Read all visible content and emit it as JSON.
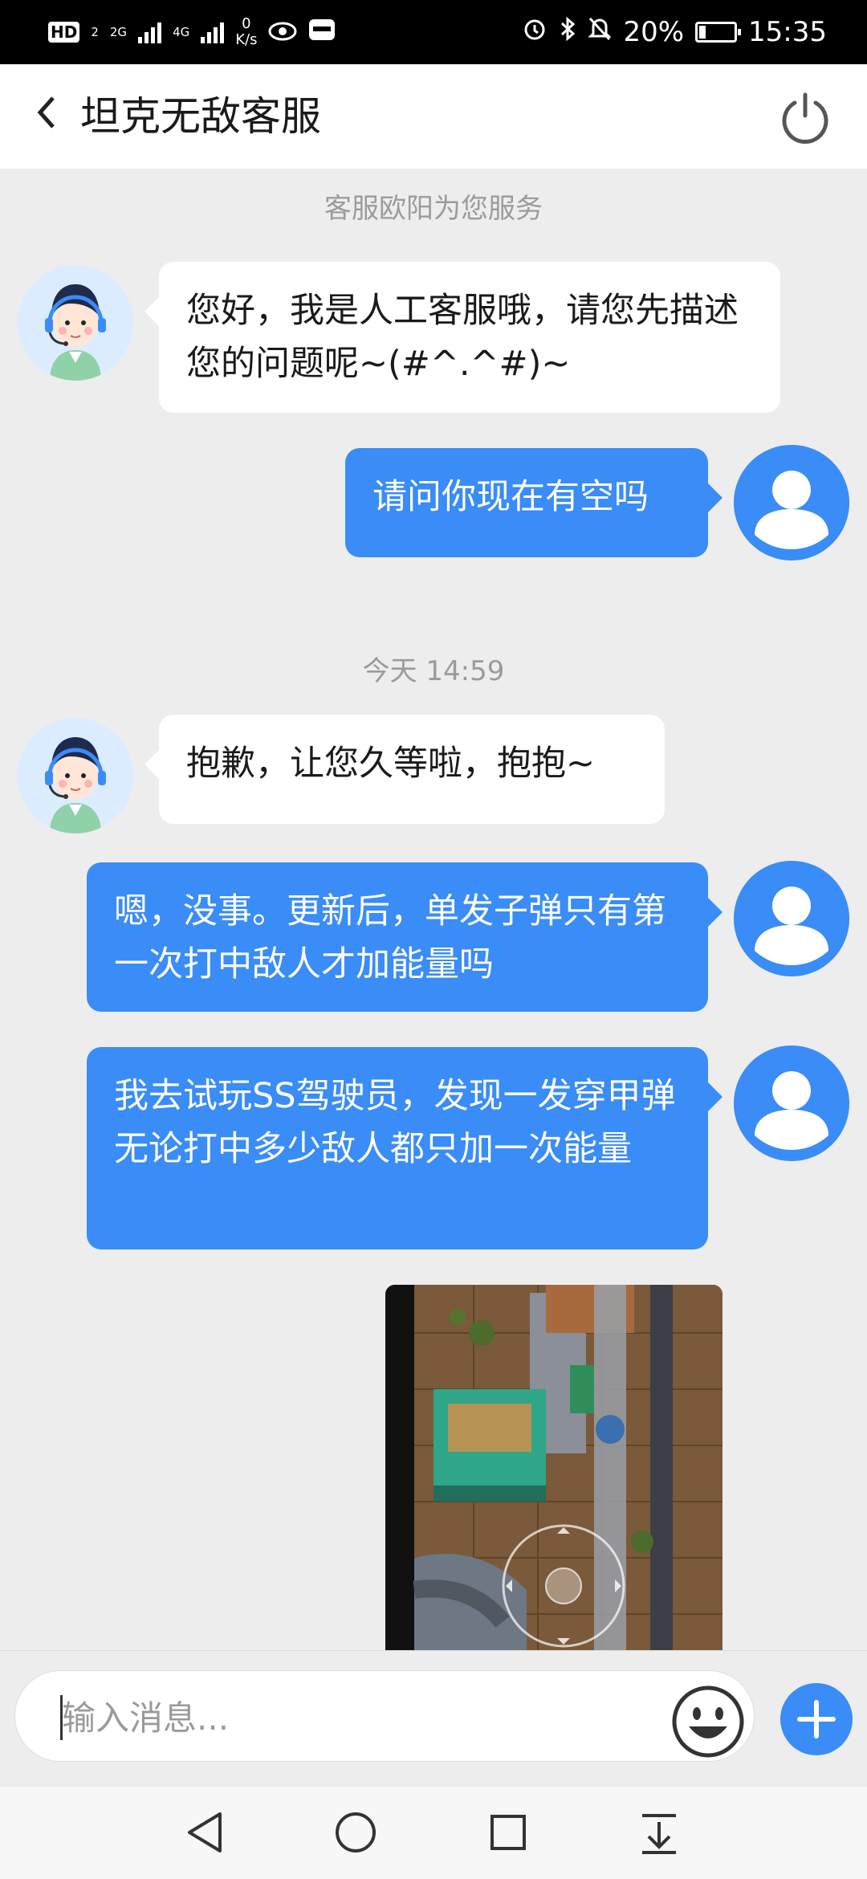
{
  "status_bar": {
    "hd_label": "HD",
    "sim1": "2",
    "net1": "2G",
    "net2": "4G",
    "speed_value": "0",
    "speed_unit": "K/s",
    "battery": "20%",
    "time": "15:35"
  },
  "header": {
    "title": "坦克无敌客服"
  },
  "chat": {
    "service_notice": "客服欧阳为您服务",
    "time_divider": "今天 14:59",
    "messages": [
      {
        "side": "agent",
        "text": "您好，我是人工客服哦，请您先描述您的问题呢~(#^.^#)~"
      },
      {
        "side": "user",
        "text": "请问你现在有空吗"
      },
      {
        "side": "agent",
        "text": "抱歉，让您久等啦，抱抱~"
      },
      {
        "side": "user",
        "text": "嗯，没事。更新后，单发子弹只有第一次打中敌人才加能量吗"
      },
      {
        "side": "user",
        "text": "我去试玩SS驾驶员，发现一发穿甲弹无论打中多少敌人都只加一次能量"
      }
    ]
  },
  "input": {
    "placeholder": "输入消息..."
  },
  "colors": {
    "accent": "#3a8cf7",
    "background": "#ededed",
    "bubble_left": "#ffffff"
  }
}
